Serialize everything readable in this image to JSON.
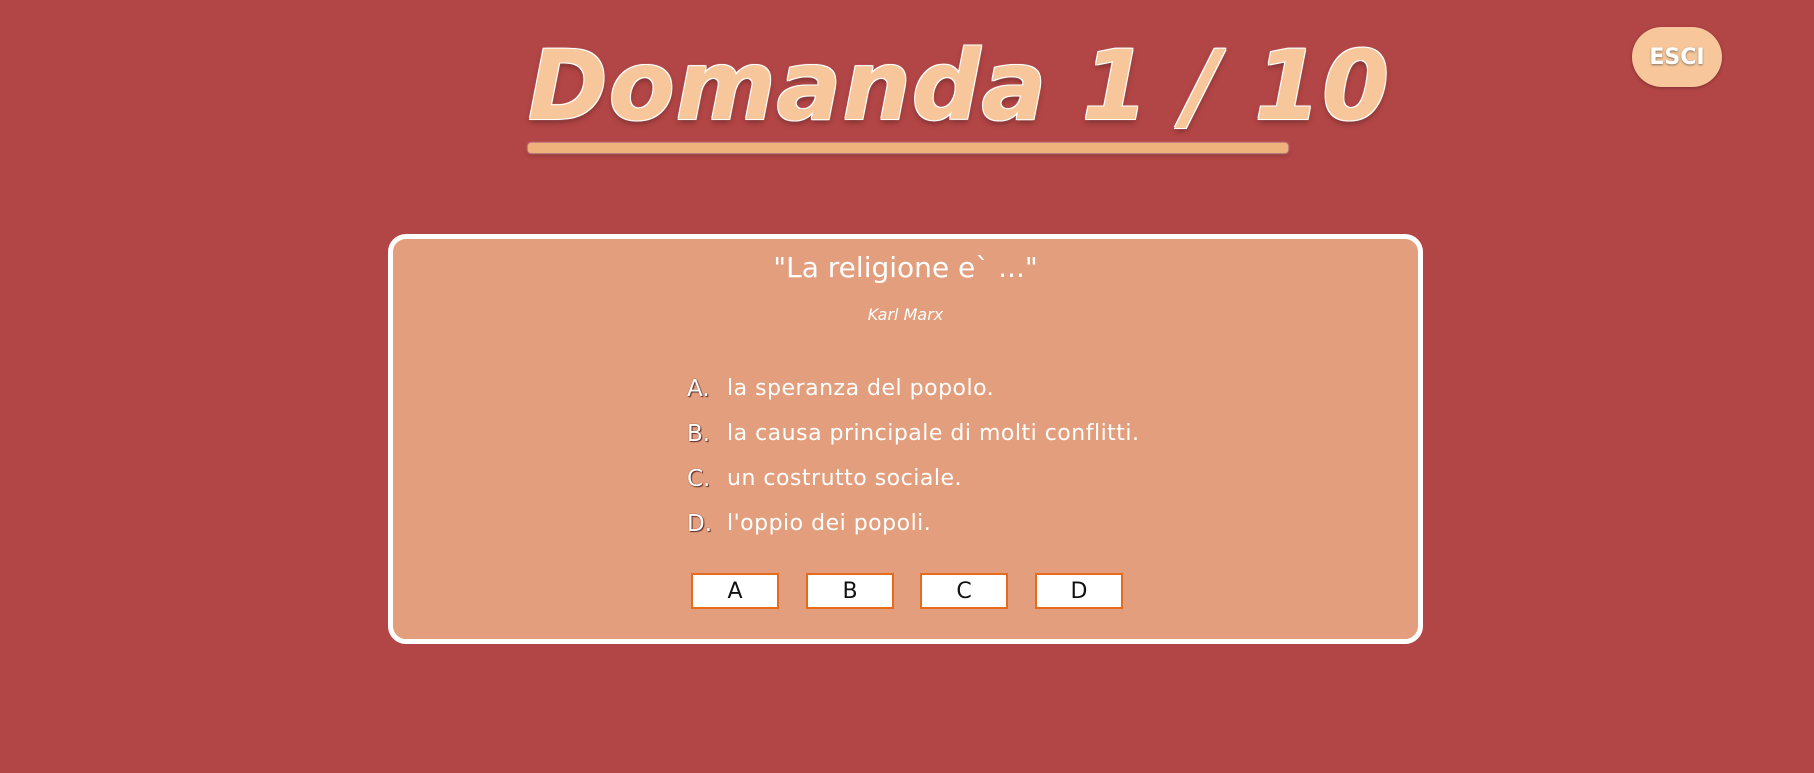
{
  "header": {
    "title": "Domanda 1 / 10",
    "exit_label": "ESCI"
  },
  "question": {
    "text": "\"La religione e` ...\"",
    "author": "Karl Marx"
  },
  "answers": [
    {
      "letter": "A.",
      "text": "la speranza del popolo."
    },
    {
      "letter": "B.",
      "text": "la causa principale di molti conflitti."
    },
    {
      "letter": "C.",
      "text": "un costrutto sociale."
    },
    {
      "letter": "D.",
      "text": "l'oppio dei popoli."
    }
  ],
  "choice_buttons": [
    "A",
    "B",
    "C",
    "D"
  ],
  "colors": {
    "background": "#b24545",
    "card": "#e39f7d",
    "title": "#f7c79b",
    "button_border": "#e76b1a"
  }
}
